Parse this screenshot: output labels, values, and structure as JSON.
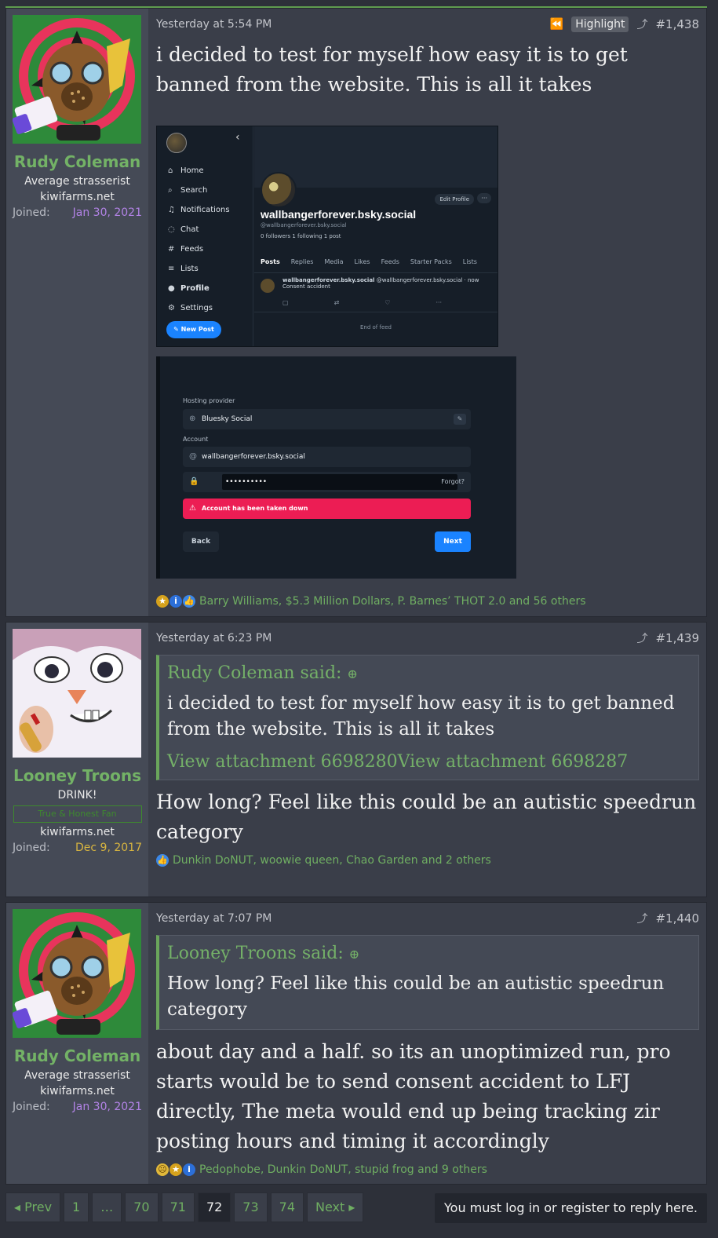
{
  "posts": [
    {
      "user": {
        "name": "Rudy Coleman",
        "title": "Average strasserist",
        "site": "kiwifarms.net",
        "joined_label": "Joined:",
        "joined_date": "Jan 30, 2021",
        "avatar_icon": "gas-mask-avatar"
      },
      "date": "Yesterday at 5:54 PM",
      "highlight_label": "Highlight",
      "number": "#1,438",
      "body": "i decided to test for myself how easy it is to get banned from the website. This is all it takes",
      "reactions": "Barry Williams, $5.3 Million Dollars, P. Barnes’ THOT 2.0 and 56 others",
      "attachment1": {
        "nav": [
          "Home",
          "Search",
          "Notifications",
          "Chat",
          "Feeds",
          "Lists",
          "Profile",
          "Settings"
        ],
        "nav_icons": [
          "home-icon",
          "search-icon",
          "bell-icon",
          "chat-icon",
          "hash-icon",
          "list-icon",
          "profile-icon",
          "gear-icon"
        ],
        "new_post": "New Post",
        "edit_profile": "Edit Profile",
        "handle": "wallbangerforever.bsky.social",
        "handle_sub": "@wallbangerforever.bsky.social",
        "followers": "0 followers  1 following  1 post",
        "tabs": [
          "Posts",
          "Replies",
          "Media",
          "Likes",
          "Feeds",
          "Starter Packs",
          "Lists"
        ],
        "post_author": "wallbangerforever.bsky.social",
        "post_meta": "@wallbangerforever.bsky.social · now",
        "post_text": "Consent accident",
        "end_of_feed": "End of feed"
      },
      "attachment2": {
        "hosting_label": "Hosting provider",
        "hosting_value": "Bluesky Social",
        "account_label": "Account",
        "account_value": "wallbangerforever.bsky.social",
        "password_mask": "••••••••••",
        "forgot": "Forgot?",
        "error": "Account has been taken down",
        "back": "Back",
        "next": "Next"
      }
    },
    {
      "user": {
        "name": "Looney Troons",
        "title": "DRINK!",
        "banner": "True & Honest Fan",
        "site": "kiwifarms.net",
        "joined_label": "Joined:",
        "joined_date": "Dec 9, 2017",
        "avatar_icon": "cartoon-rabbit-avatar"
      },
      "date": "Yesterday at 6:23 PM",
      "number": "#1,439",
      "quote_author": "Rudy Coleman said:",
      "quote_body": "i decided to test for myself how easy it is to get banned from the website. This is all it takes",
      "quote_links": "View attachment 6698280View attachment 6698287",
      "body": "How long? Feel like this could be an autistic speedrun category",
      "reactions": "Dunkin DoNUT, woowie queen, Chao Garden and 2 others"
    },
    {
      "user": {
        "name": "Rudy Coleman",
        "title": "Average strasserist",
        "site": "kiwifarms.net",
        "joined_label": "Joined:",
        "joined_date": "Jan 30, 2021",
        "avatar_icon": "gas-mask-avatar"
      },
      "date": "Yesterday at 7:07 PM",
      "number": "#1,440",
      "quote_author": "Looney Troons said:",
      "quote_body": "How long? Feel like this could be an autistic speedrun category",
      "body": "about day and a half. so its an unoptimized run, pro starts would be to send consent accident to LFJ directly, The meta would end up being tracking zir posting hours and timing it accordingly",
      "reactions": "Pedophobe, Dunkin DoNUT, stupid frog and 9 others"
    }
  ],
  "pagination": {
    "prev": "Prev",
    "pages": [
      "1",
      "…",
      "70",
      "71",
      "72",
      "73",
      "74"
    ],
    "current": "72",
    "next": "Next"
  },
  "login_notice": "You must log in or register to reply here.",
  "colors": {
    "accent_green": "#73b266",
    "purple_date": "#b283e6",
    "gold_date": "#d8b540",
    "error_red": "#ec1d54",
    "bluesky_blue": "#1a83ff"
  }
}
